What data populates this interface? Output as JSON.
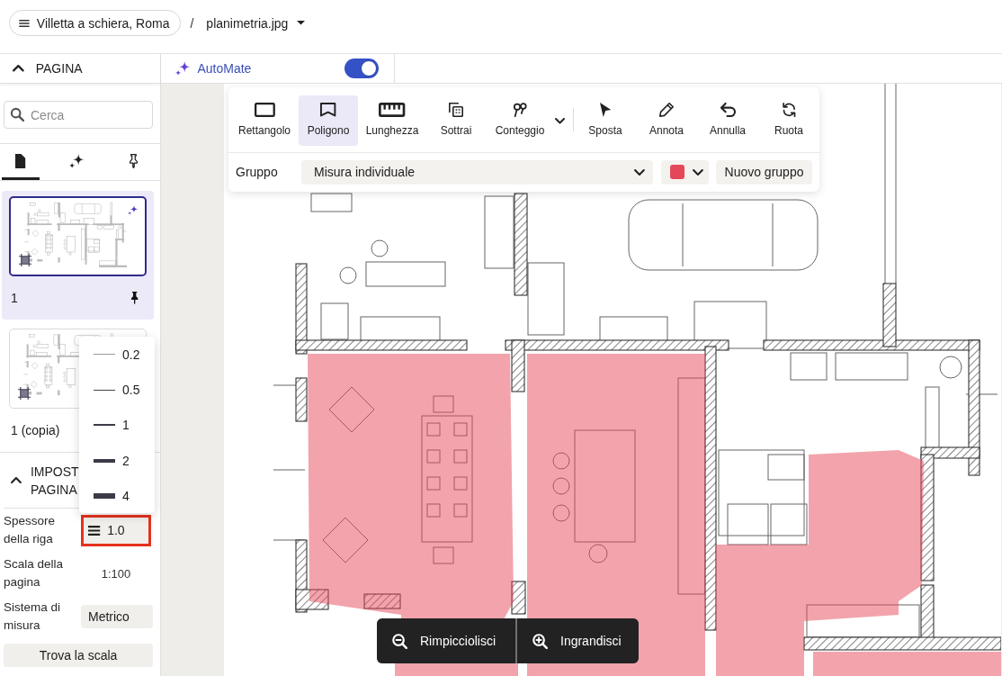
{
  "breadcrumb": {
    "project": "Villetta a schiera, Roma",
    "separator": "/",
    "file": "planimetria.jpg"
  },
  "sidebar": {
    "section": {
      "title": "PAGINA",
      "expanded": true
    },
    "search": {
      "placeholder": "Cerca"
    },
    "tabs": [
      {
        "kind": "document",
        "selected": true
      },
      {
        "kind": "sparkle",
        "selected": false
      },
      {
        "kind": "pin",
        "selected": false
      }
    ],
    "pages": [
      {
        "label": "1",
        "selected": true,
        "automated": true,
        "pinned": true
      },
      {
        "label": "1 (copia)",
        "selected": false,
        "automated": false,
        "pinned": false
      }
    ],
    "settings": {
      "title": "IMPOST PAGINA",
      "expanded": true,
      "line_weight": {
        "label": "Spessore della riga",
        "value": "1.0",
        "highlighted": true,
        "menu_open": true,
        "options": [
          "0.2",
          "0.5",
          "1",
          "2",
          "4"
        ]
      },
      "scale": {
        "label": "Scala della pagina",
        "value": "1:100"
      },
      "units": {
        "label": "Sistema di misura",
        "value": "Metrico"
      },
      "find_scale": "Trova la scala"
    }
  },
  "automate": {
    "label": "AutoMate",
    "on": true
  },
  "toolbar": {
    "measure_tools": [
      {
        "kind": "rectangle",
        "label": "Rettangolo",
        "selected": false,
        "has_menu": false
      },
      {
        "kind": "polygon",
        "label": "Poligono",
        "selected": true,
        "has_menu": false
      },
      {
        "kind": "length",
        "label": "Lunghezza",
        "selected": false,
        "has_menu": false
      },
      {
        "kind": "subtract",
        "label": "Sottrai",
        "selected": false,
        "has_menu": false
      },
      {
        "kind": "count",
        "label": "Conteggio",
        "selected": false,
        "has_menu": true
      }
    ],
    "edit_tools": [
      {
        "kind": "move",
        "label": "Sposta",
        "selected": false
      },
      {
        "kind": "annotate",
        "label": "Annota",
        "selected": false
      },
      {
        "kind": "undo",
        "label": "Annulla",
        "selected": false
      },
      {
        "kind": "rotate",
        "label": "Ruota",
        "selected": false
      }
    ],
    "group": {
      "label": "Gruppo",
      "value": "Misura individuale",
      "color": "#e5475a",
      "new_group": "Nuovo gruppo"
    }
  },
  "zoom": {
    "zoom_out": "Rimpicciolisci",
    "zoom_in": "Ingrandisci"
  }
}
